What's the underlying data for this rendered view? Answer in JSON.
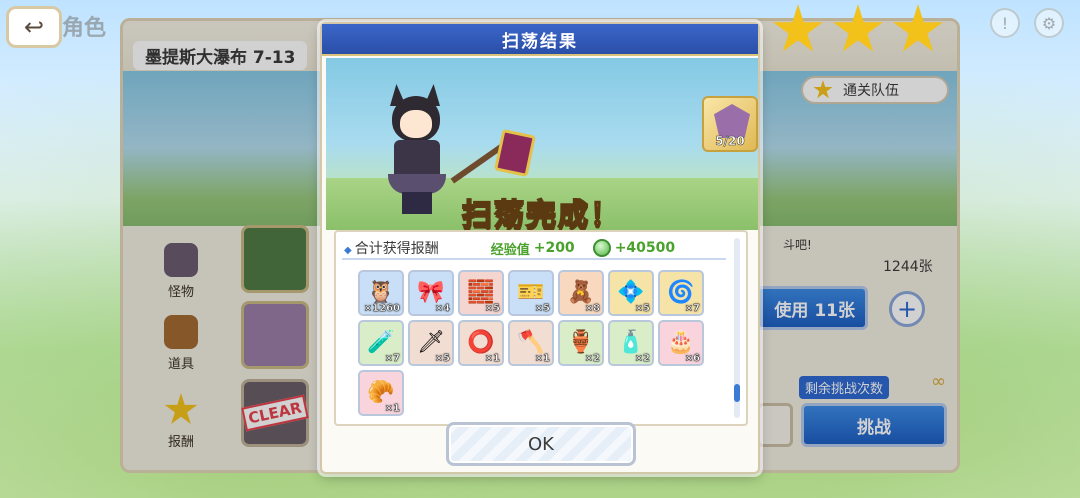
{
  "top": {
    "back_icon": "back-arrow-icon",
    "title": "角色"
  },
  "stage": {
    "name": "墨提斯大瀑布 7-13",
    "tabs": [
      {
        "label": "怪物",
        "icon": "monster-icon",
        "color": "#6b5b6f"
      },
      {
        "label": "道具",
        "icon": "chest-icon",
        "color": "#a46a32"
      },
      {
        "label": "报酬",
        "icon": "star-icon",
        "color": "#f2c21b"
      }
    ],
    "clear_stamp": "CLEAR",
    "party_button": "通关队伍",
    "hint": "斗吧!",
    "ticket_count": "1244张",
    "use_button": "使用 11张",
    "plus_button": "+",
    "remaining_label": "剩余挑战次数",
    "remaining_value": "∞",
    "challenge_button": "挑战",
    "stars": 3
  },
  "modal": {
    "title": "扫荡结果",
    "banner_text": "扫荡完成！",
    "shard_count": "5/20",
    "rewards": {
      "title": "合计获得报酬",
      "exp_label": "经验值",
      "exp_value": "+200",
      "mana_value": "+40500",
      "items": [
        {
          "glyph": "🦉",
          "qty": "×1260",
          "bg": "#c9dff7",
          "name": "item-experience-potion"
        },
        {
          "glyph": "🎀",
          "qty": "×4",
          "bg": "#c9dff7",
          "name": "item-ribbon"
        },
        {
          "glyph": "🧱",
          "qty": "×5",
          "bg": "#f5d5cf",
          "name": "item-ore"
        },
        {
          "glyph": "🎫",
          "qty": "×5",
          "bg": "#c9dff7",
          "name": "item-ticket"
        },
        {
          "glyph": "🧸",
          "qty": "×8",
          "bg": "#f8d9bf",
          "name": "item-shard-1"
        },
        {
          "glyph": "💠",
          "qty": "×5",
          "bg": "#f6e3a7",
          "name": "item-shard-2"
        },
        {
          "glyph": "🌀",
          "qty": "×7",
          "bg": "#f6e3a7",
          "name": "item-shard-3"
        },
        {
          "glyph": "🧪",
          "qty": "×7",
          "bg": "#d9eec8",
          "name": "item-potion"
        },
        {
          "glyph": "🗡",
          "qty": "×5",
          "bg": "#f1ddd2",
          "name": "item-spear"
        },
        {
          "glyph": "⭕",
          "qty": "×1",
          "bg": "#f1ddd2",
          "name": "item-bracelet"
        },
        {
          "glyph": "🪓",
          "qty": "×1",
          "bg": "#f1ddd2",
          "name": "item-axe"
        },
        {
          "glyph": "🏺",
          "qty": "×2",
          "bg": "#d9eec8",
          "name": "item-vase"
        },
        {
          "glyph": "🧴",
          "qty": "×2",
          "bg": "#d9eec8",
          "name": "item-bottle"
        },
        {
          "glyph": "🎂",
          "qty": "×6",
          "bg": "#f9d4dc",
          "name": "item-cake"
        },
        {
          "glyph": "🥐",
          "qty": "×1",
          "bg": "#f9d4dc",
          "name": "item-pastry"
        }
      ]
    },
    "ok_button": "OK"
  }
}
